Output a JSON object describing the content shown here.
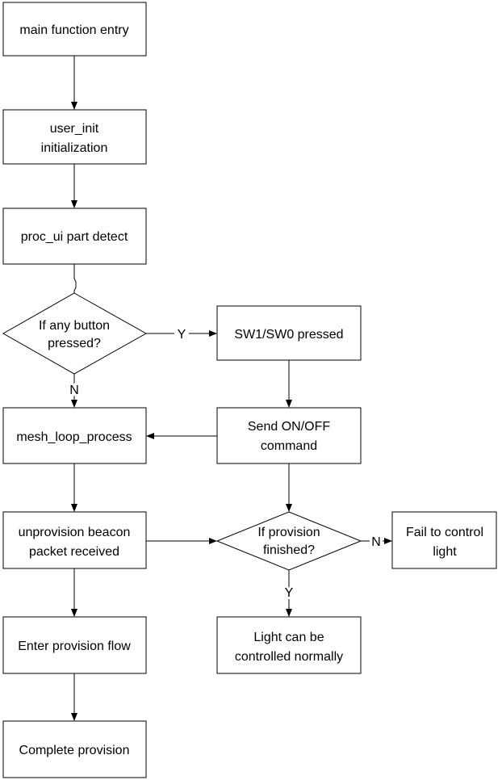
{
  "nodes": {
    "main_entry": {
      "lines": [
        "main function entry"
      ]
    },
    "user_init": {
      "lines": [
        "user_init",
        "initialization"
      ]
    },
    "proc_ui": {
      "lines": [
        "proc_ui part detect"
      ]
    },
    "button_decision": {
      "lines": [
        "If any button",
        "pressed?"
      ]
    },
    "sw_pressed": {
      "lines": [
        "SW1/SW0 pressed"
      ]
    },
    "mesh_loop": {
      "lines": [
        "mesh_loop_process"
      ]
    },
    "send_onoff": {
      "lines": [
        "Send ON/OFF",
        "command"
      ]
    },
    "unprovision": {
      "lines": [
        "unprovision beacon",
        "packet received"
      ]
    },
    "provision_decision": {
      "lines": [
        "If provision",
        "finished?"
      ]
    },
    "fail": {
      "lines": [
        "Fail to control",
        "light"
      ]
    },
    "enter_provision": {
      "lines": [
        "Enter provision flow"
      ]
    },
    "light_normal": {
      "lines": [
        "Light can be",
        "controlled normally"
      ]
    },
    "complete": {
      "lines": [
        "Complete provision"
      ]
    }
  },
  "edge_labels": {
    "button_yes": "Y",
    "button_no": "N",
    "provision_no": "N",
    "provision_yes": "Y"
  }
}
